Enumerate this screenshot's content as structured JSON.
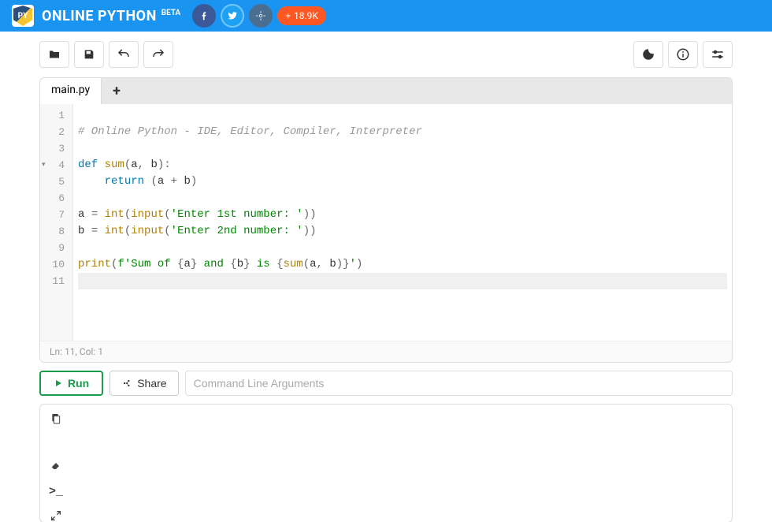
{
  "header": {
    "logo_text": "PY",
    "title": "ONLINE PYTHON",
    "beta": "BETA",
    "share_count": "18.9K"
  },
  "toolbar": {
    "open": "Open",
    "save": "Save",
    "undo": "Undo",
    "redo": "Redo",
    "dark": "Dark Mode",
    "info": "Info",
    "settings": "Settings"
  },
  "tabs": {
    "active": "main.py",
    "add": "+"
  },
  "code": {
    "lines": [
      "",
      "# Online Python - IDE, Editor, Compiler, Interpreter",
      "",
      "def sum(a, b):",
      "    return (a + b)",
      "",
      "a = int(input('Enter 1st number: '))",
      "b = int(input('Enter 2nd number: '))",
      "",
      "print(f'Sum of {a} and {b} is {sum(a, b)}')",
      ""
    ]
  },
  "status": {
    "position": "Ln: 11,  Col: 1"
  },
  "actions": {
    "run": "Run",
    "share": "Share",
    "cmd_placeholder": "Command Line Arguments"
  }
}
